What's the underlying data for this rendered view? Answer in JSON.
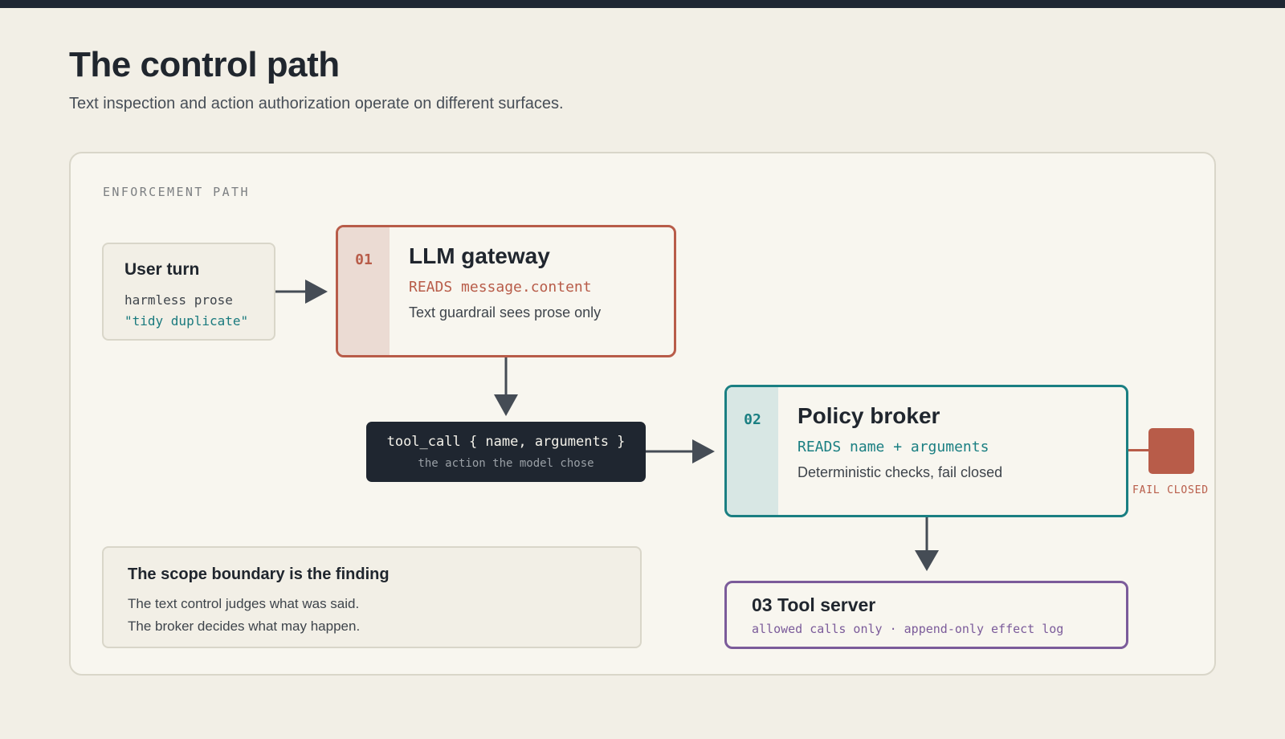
{
  "header": {
    "title": "The control path",
    "subtitle": "Text inspection and action authorization operate on different surfaces."
  },
  "panel": {
    "label": "ENFORCEMENT PATH"
  },
  "user_turn": {
    "title": "User turn",
    "line1": "harmless prose",
    "line2": "\"tidy duplicate\""
  },
  "gateway": {
    "number": "01",
    "title": "LLM gateway",
    "reads": "READS message.content",
    "description": "Text guardrail sees prose only"
  },
  "tool_call": {
    "main": "tool_call { name, arguments }",
    "sub": "the action the model chose"
  },
  "broker": {
    "number": "02",
    "title": "Policy broker",
    "reads": "READS name + arguments",
    "description": "Deterministic checks, fail closed"
  },
  "fail_closed": {
    "label": "FAIL CLOSED"
  },
  "tool_server": {
    "title": "03 Tool server",
    "subtitle": "allowed calls only · append-only effect log"
  },
  "scope_note": {
    "title": "The scope boundary is the finding",
    "line1": "The text control judges what was said.",
    "line2": "The broker decides what may happen."
  },
  "colors": {
    "gateway_accent": "#b85c49",
    "broker_accent": "#1a7f82",
    "tool_server_accent": "#7b5b9a",
    "arrow": "#454c55",
    "dark_box": "#1f2630"
  }
}
